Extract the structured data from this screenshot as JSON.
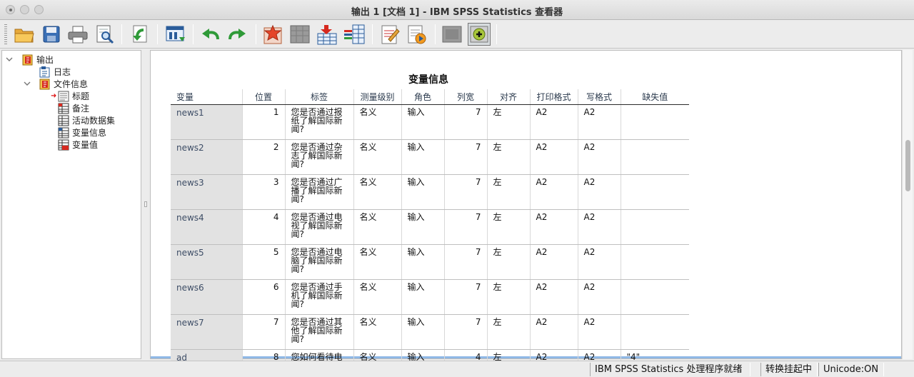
{
  "window": {
    "title": "输出 1 [文档 1] - IBM SPSS Statistics 查看器"
  },
  "toolbar": {
    "buttons": [
      {
        "name": "open-folder-icon"
      },
      {
        "name": "save-icon"
      },
      {
        "name": "print-icon"
      },
      {
        "name": "print-preview-icon"
      },
      {
        "name": "export-icon"
      },
      {
        "name": "goto-data-icon"
      },
      {
        "name": "undo-icon"
      },
      {
        "name": "redo-icon"
      },
      {
        "name": "goto-case-icon"
      },
      {
        "name": "goto-variable-icon"
      },
      {
        "name": "insert-cases-icon"
      },
      {
        "name": "variables-icon"
      },
      {
        "name": "designate-window-icon"
      },
      {
        "name": "run-script-icon"
      },
      {
        "name": "show-hide-icon"
      },
      {
        "name": "add-output-icon"
      }
    ]
  },
  "nav": {
    "items": [
      {
        "label": "输出",
        "level": 0
      },
      {
        "label": "日志",
        "level": 2
      },
      {
        "label": "文件信息",
        "level": 1
      },
      {
        "label": "标题",
        "level": 2,
        "current": true
      },
      {
        "label": "备注",
        "level": 2
      },
      {
        "label": "活动数据集",
        "level": 2
      },
      {
        "label": "变量信息",
        "level": 2
      },
      {
        "label": "变量值",
        "level": 2
      }
    ]
  },
  "table": {
    "title": "变量信息",
    "headers": [
      "变量",
      "位置",
      "标签",
      "测量级别",
      "角色",
      "列宽",
      "对齐",
      "打印格式",
      "写格式",
      "缺失值"
    ],
    "rows": [
      [
        "news1",
        "1",
        "您是否通过报纸了解国际新闻?",
        "名义",
        "输入",
        "7",
        "左",
        "A2",
        "A2",
        ""
      ],
      [
        "news2",
        "2",
        "您是否通过杂志了解国际新闻?",
        "名义",
        "输入",
        "7",
        "左",
        "A2",
        "A2",
        ""
      ],
      [
        "news3",
        "3",
        "您是否通过广播了解国际新闻?",
        "名义",
        "输入",
        "7",
        "左",
        "A2",
        "A2",
        ""
      ],
      [
        "news4",
        "4",
        "您是否通过电视了解国际新闻?",
        "名义",
        "输入",
        "7",
        "左",
        "A2",
        "A2",
        ""
      ],
      [
        "news5",
        "5",
        "您是否通过电脑了解国际新闻?",
        "名义",
        "输入",
        "7",
        "左",
        "A2",
        "A2",
        ""
      ],
      [
        "news6",
        "6",
        "您是否通过手机了解国际新闻?",
        "名义",
        "输入",
        "7",
        "左",
        "A2",
        "A2",
        ""
      ],
      [
        "news7",
        "7",
        "您是否通过其他了解国际新闻?",
        "名义",
        "输入",
        "7",
        "左",
        "A2",
        "A2",
        ""
      ],
      [
        "ad",
        "8",
        "您如何看待电",
        "名义",
        "输入",
        "4",
        "左",
        "A2",
        "A2",
        "\"4\""
      ]
    ]
  },
  "status": {
    "processor": "IBM SPSS Statistics 处理程序就绪",
    "transform": "转换挂起中",
    "unicode": "Unicode:ON"
  },
  "colors": {
    "rowhead_bg": "#e2e2e2",
    "accent": "#8fb8e6",
    "header_text": "#2b3a4d"
  }
}
